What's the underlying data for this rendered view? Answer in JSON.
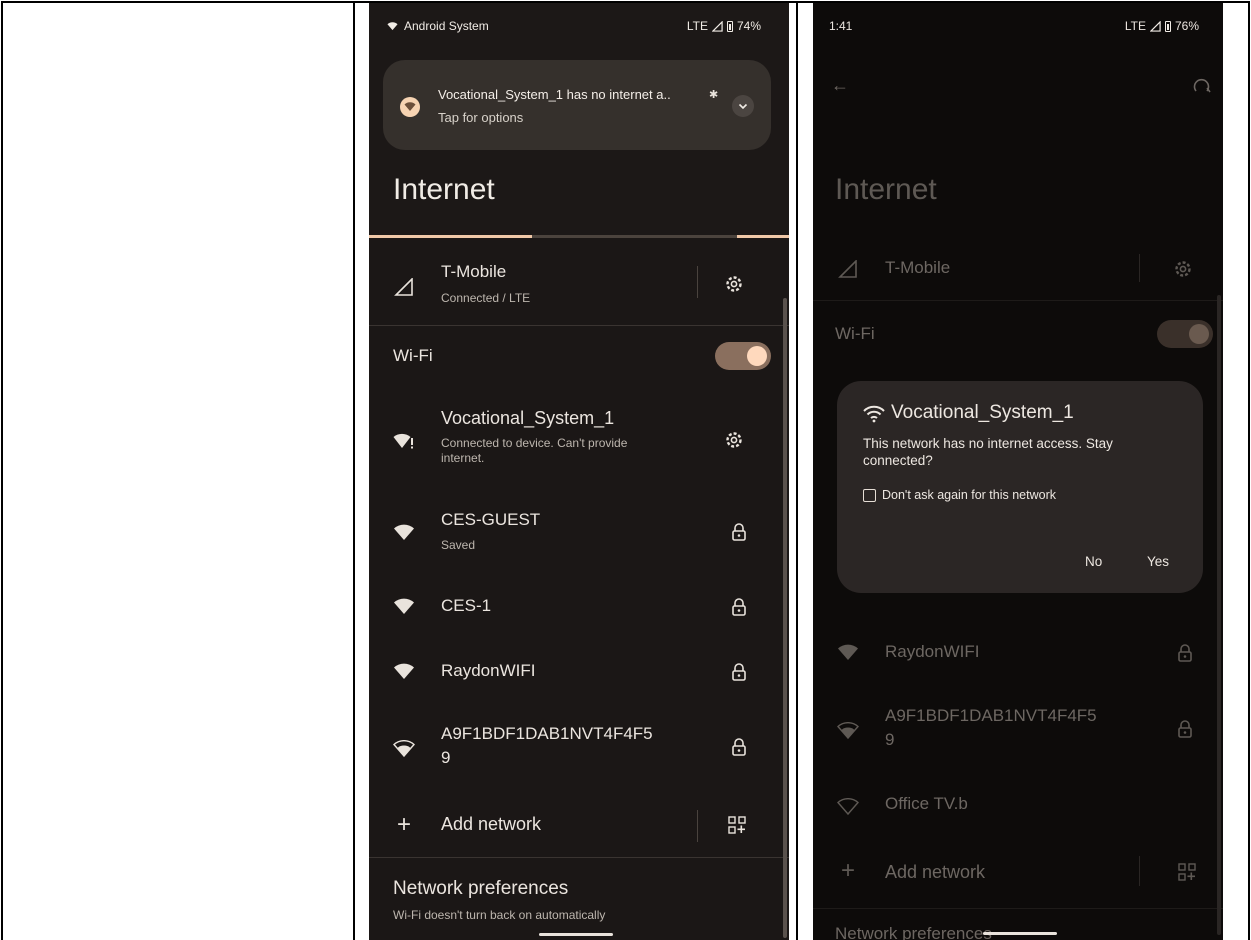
{
  "left_screen": {
    "status": {
      "app": "Android System",
      "network": "LTE",
      "battery": "74%"
    },
    "notification": {
      "title": "Vocational_System_1 has no internet a..",
      "subtitle": "Tap for options"
    },
    "page_title": "Internet",
    "mobile": {
      "name": "T-Mobile",
      "status": "Connected / LTE"
    },
    "wifi_label": "Wi-Fi",
    "networks": [
      {
        "name": "Vocational_System_1",
        "sub1": "Connected to device. Can't provide",
        "sub2": "internet."
      },
      {
        "name": "CES-GUEST",
        "sub1": "Saved",
        "sub2": ""
      },
      {
        "name": "CES-1",
        "sub1": "",
        "sub2": ""
      },
      {
        "name": "RaydonWIFI",
        "sub1": "",
        "sub2": ""
      },
      {
        "name": "A9F1BDF1DAB1NVT4F4F5",
        "sub1": "9",
        "sub2": ""
      }
    ],
    "add_network": "Add network",
    "preferences": {
      "title": "Network preferences",
      "sub": "Wi-Fi doesn't turn back on automatically"
    }
  },
  "right_screen": {
    "status": {
      "time": "1:41",
      "network": "LTE",
      "battery": "76%"
    },
    "page_title": "Internet",
    "mobile": {
      "name": "T-Mobile"
    },
    "wifi_label": "Wi-Fi",
    "dialog": {
      "title": "Vocational_System_1",
      "message": "This network has no internet access. Stay connected?",
      "checkbox_label": "Don't ask again for this network",
      "no_label": "No",
      "yes_label": "Yes"
    },
    "networks": [
      {
        "name": "RaydonWIFI"
      },
      {
        "name": "A9F1BDF1DAB1NVT4F4F5",
        "sub": "9"
      },
      {
        "name": "Office TV.b"
      }
    ],
    "add_network": "Add network",
    "preferences_title": "Network preferences"
  },
  "colors": {
    "accent": "#f0c8a8",
    "toggle_track": "#8a6f5e",
    "background": "#1c1817"
  },
  "icons": [
    "wifi-icon",
    "lock-icon",
    "gear-icon",
    "cellular-icon",
    "plus-icon",
    "qr-code-icon",
    "back-arrow-icon",
    "help-icon",
    "chevron-down-icon",
    "bell-icon"
  ]
}
